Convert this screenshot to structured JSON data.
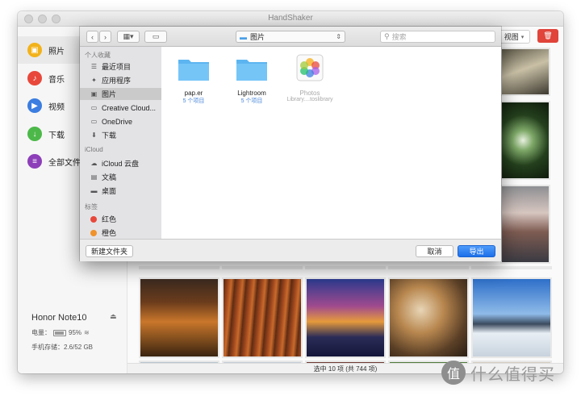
{
  "window": {
    "title": "HandShaker"
  },
  "nav": [
    {
      "label": "照片",
      "color": "#f2b21a",
      "icon": "photo-icon",
      "glyph": "▣"
    },
    {
      "label": "音乐",
      "color": "#e8483b",
      "icon": "music-icon",
      "glyph": "♪"
    },
    {
      "label": "视频",
      "color": "#3b7de0",
      "icon": "video-icon",
      "glyph": "▶"
    },
    {
      "label": "下载",
      "color": "#4cb849",
      "icon": "download-icon",
      "glyph": "↓"
    },
    {
      "label": "全部文件",
      "color": "#8c3fb8",
      "icon": "files-icon",
      "glyph": "≡"
    }
  ],
  "device": {
    "name": "Honor Note10",
    "battery_label": "电量：",
    "battery_value": "95%",
    "battery_level": 0.95,
    "storage": "手机存储：2.6/52 GB"
  },
  "toolbar": {
    "view_label": "视图"
  },
  "status": {
    "text": "选中 10 项 (共 744 项)"
  },
  "dialog": {
    "location": "图片",
    "search_placeholder": "搜索",
    "sections": {
      "favorites": "个人收藏",
      "icloud": "iCloud",
      "tags": "标签"
    },
    "favorites": [
      {
        "label": "最近项目",
        "icon": "recents-icon",
        "glyph": "☰"
      },
      {
        "label": "应用程序",
        "icon": "applications-icon",
        "glyph": "✦"
      },
      {
        "label": "图片",
        "icon": "pictures-icon",
        "glyph": "▣",
        "active": true
      },
      {
        "label": "Creative Cloud...",
        "icon": "folder-icon",
        "glyph": "▭"
      },
      {
        "label": "OneDrive",
        "icon": "folder-icon",
        "glyph": "▭"
      },
      {
        "label": "下载",
        "icon": "downloads-icon",
        "glyph": "⬇"
      }
    ],
    "icloud": [
      {
        "label": "iCloud 云盘",
        "icon": "cloud-icon",
        "glyph": "☁"
      },
      {
        "label": "文稿",
        "icon": "documents-icon",
        "glyph": "▤"
      },
      {
        "label": "桌面",
        "icon": "desktop-icon",
        "glyph": "▬"
      }
    ],
    "tags": [
      {
        "label": "红色",
        "color": "#e8483b"
      },
      {
        "label": "橙色",
        "color": "#f0932b"
      }
    ],
    "files": [
      {
        "name": "pap.er",
        "sub": "5 个项目",
        "kind": "folder"
      },
      {
        "name": "Lightroom",
        "sub": "5 个项目",
        "kind": "folder"
      },
      {
        "name": "Photos",
        "sub": "Library....toslibrary",
        "kind": "photos"
      }
    ],
    "new_folder_button": "新建文件夹",
    "cancel_button": "取消",
    "export_button": "导出"
  },
  "watermark": {
    "text": "什么值得买",
    "glyph": "值"
  }
}
